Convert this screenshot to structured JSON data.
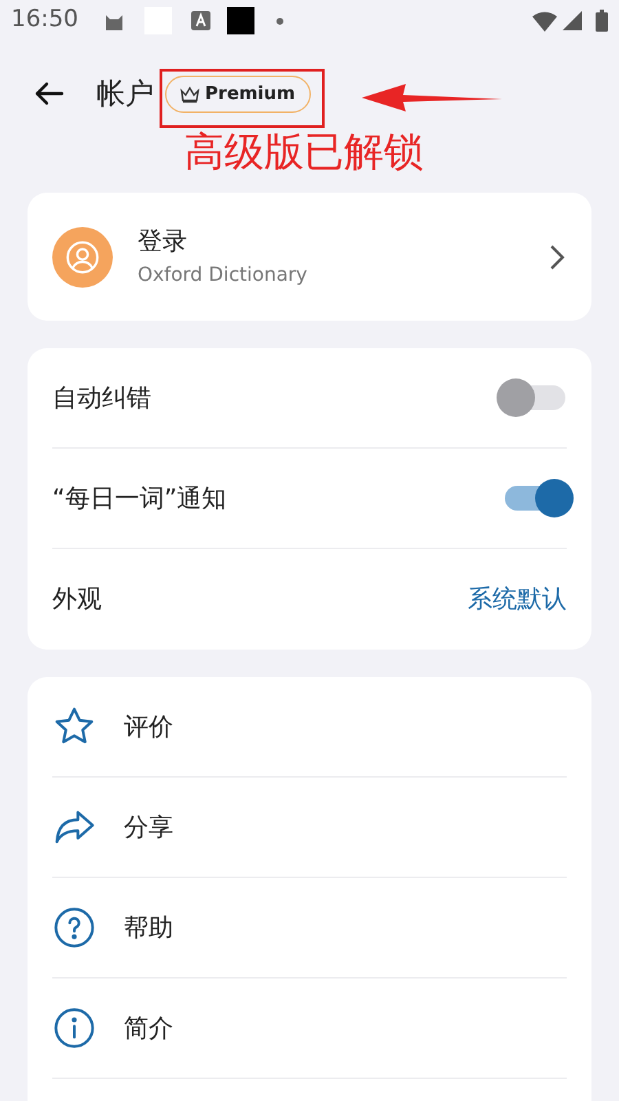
{
  "status_bar": {
    "time": "16:50"
  },
  "header": {
    "title": "帐户",
    "badge": "Premium"
  },
  "annotation": {
    "text": "高级版已解锁"
  },
  "account": {
    "title": "登录",
    "subtitle": "Oxford Dictionary"
  },
  "settings": [
    {
      "kind": "toggle",
      "label": "自动纠错",
      "on": false
    },
    {
      "kind": "toggle",
      "label": "“每日一词”通知",
      "on": true
    },
    {
      "kind": "value",
      "label": "外观",
      "value": "系统默认"
    }
  ],
  "menu": [
    {
      "kind": "star",
      "label": "评价"
    },
    {
      "kind": "share",
      "label": "分享"
    },
    {
      "kind": "help",
      "label": "帮助"
    },
    {
      "kind": "info",
      "label": "简介"
    }
  ]
}
